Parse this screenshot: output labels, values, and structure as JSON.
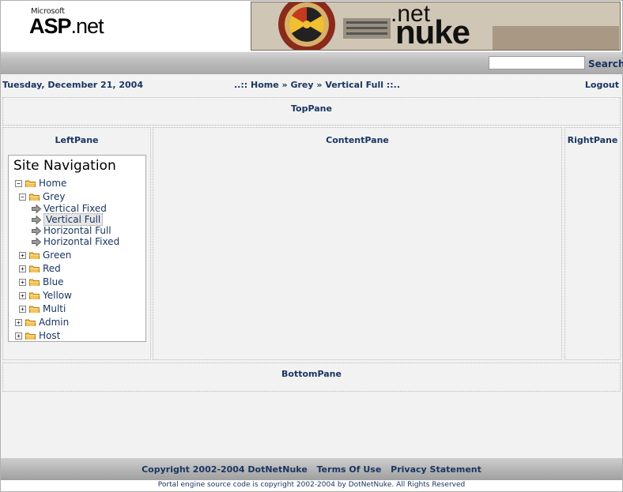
{
  "header": {
    "logo_microsoft": "Microsoft",
    "logo_asp": "ASP",
    "logo_net": ".net",
    "banner_net": ".net",
    "banner_nuke": "nuke"
  },
  "search": {
    "placeholder": "",
    "button_label": "Search"
  },
  "infobar": {
    "date": "Tuesday, December 21, 2004",
    "crumb_prefix": "..:: ",
    "crumbs": [
      "Home",
      "Grey",
      "Vertical Full"
    ],
    "crumb_sep": " » ",
    "crumb_suffix": " ::..",
    "logout_label": "Logout"
  },
  "panes": {
    "top": "TopPane",
    "left": "LeftPane",
    "content": "ContentPane",
    "right": "RightPane",
    "bottom": "BottomPane"
  },
  "navigation": {
    "title": "Site Navigation",
    "nodes": [
      {
        "label": "Home",
        "level": 0,
        "expander": "−",
        "type": "folder"
      },
      {
        "label": "Grey",
        "level": 1,
        "expander": "−",
        "type": "folder"
      },
      {
        "label": "Vertical Fixed",
        "level": 2,
        "expander": "",
        "type": "page"
      },
      {
        "label": "Vertical Full",
        "level": 2,
        "expander": "",
        "type": "page",
        "selected": true
      },
      {
        "label": "Horizontal Full",
        "level": 2,
        "expander": "",
        "type": "page"
      },
      {
        "label": "Horizontal Fixed",
        "level": 2,
        "expander": "",
        "type": "page"
      },
      {
        "label": "Green",
        "level": 1,
        "expander": "+",
        "type": "folder"
      },
      {
        "label": "Red",
        "level": 1,
        "expander": "+",
        "type": "folder"
      },
      {
        "label": "Blue",
        "level": 1,
        "expander": "+",
        "type": "folder"
      },
      {
        "label": "Yellow",
        "level": 1,
        "expander": "+",
        "type": "folder"
      },
      {
        "label": "Multi",
        "level": 1,
        "expander": "+",
        "type": "folder"
      },
      {
        "label": "Admin",
        "level": 0,
        "expander": "+",
        "type": "folder"
      },
      {
        "label": "Host",
        "level": 0,
        "expander": "+",
        "type": "folder"
      }
    ]
  },
  "footer": {
    "copyright": "Copyright 2002-2004 DotNetNuke",
    "terms": "Terms Of Use",
    "privacy": "Privacy Statement",
    "engine_note": "Portal engine source code is copyright 2002-2004 by DotNetNuke. All Rights Reserved"
  },
  "colors": {
    "link": "#1a3561",
    "bar": "#bdbdbd",
    "page_bg": "#f2f2f2"
  }
}
